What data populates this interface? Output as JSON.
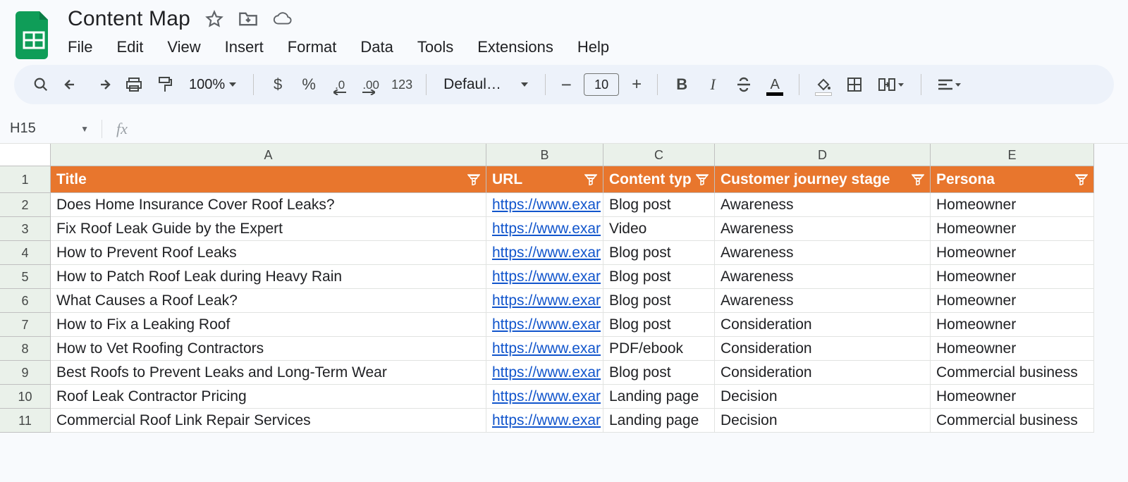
{
  "doc": {
    "title": "Content Map"
  },
  "menu": {
    "file": "File",
    "edit": "Edit",
    "view": "View",
    "insert": "Insert",
    "format": "Format",
    "data": "Data",
    "tools": "Tools",
    "extensions": "Extensions",
    "help": "Help"
  },
  "toolbar": {
    "zoom": "100%",
    "currency": "$",
    "percent": "%",
    "dec_dec": ".0",
    "inc_dec": ".00",
    "num123": "123",
    "font": "Defaul…",
    "font_size": "10",
    "bold": "B",
    "italic": "I",
    "text_color": "A"
  },
  "namebox": {
    "ref": "H15"
  },
  "formulabar": {
    "fx": "fx",
    "value": ""
  },
  "columns": [
    "A",
    "B",
    "C",
    "D",
    "E"
  ],
  "headers": {
    "title": "Title",
    "url": "URL",
    "content_type": "Content typ",
    "journey": "Customer journey stage",
    "persona": "Persona"
  },
  "rows": [
    {
      "n": "2",
      "title": "Does Home Insurance Cover Roof Leaks?",
      "url": "https://www.exar",
      "type": "Blog post",
      "stage": "Awareness",
      "persona": "Homeowner"
    },
    {
      "n": "3",
      "title": "Fix Roof Leak Guide by the Expert",
      "url": "https://www.exar",
      "type": "Video",
      "stage": "Awareness",
      "persona": "Homeowner"
    },
    {
      "n": "4",
      "title": "How to Prevent Roof Leaks",
      "url": "https://www.exar",
      "type": "Blog post",
      "stage": "Awareness",
      "persona": "Homeowner"
    },
    {
      "n": "5",
      "title": "How to Patch Roof Leak during Heavy Rain",
      "url": "https://www.exar",
      "type": "Blog post",
      "stage": "Awareness",
      "persona": "Homeowner"
    },
    {
      "n": "6",
      "title": "What Causes a Roof Leak?",
      "url": "https://www.exar",
      "type": "Blog post",
      "stage": "Awareness",
      "persona": "Homeowner"
    },
    {
      "n": "7",
      "title": "How to Fix a Leaking Roof",
      "url": "https://www.exar",
      "type": "Blog post",
      "stage": "Consideration",
      "persona": "Homeowner"
    },
    {
      "n": "8",
      "title": "How to Vet Roofing Contractors",
      "url": "https://www.exar",
      "type": "PDF/ebook",
      "stage": "Consideration",
      "persona": "Homeowner"
    },
    {
      "n": "9",
      "title": "Best Roofs to Prevent Leaks and Long-Term Wear",
      "url": "https://www.exar",
      "type": "Blog post",
      "stage": "Consideration",
      "persona": "Commercial business"
    },
    {
      "n": "10",
      "title": "Roof Leak Contractor Pricing",
      "url": "https://www.exar",
      "type": "Landing page",
      "stage": "Decision",
      "persona": "Homeowner"
    },
    {
      "n": "11",
      "title": "Commercial Roof Link Repair Services",
      "url": "https://www.exar",
      "type": "Landing page",
      "stage": "Decision",
      "persona": "Commercial business"
    }
  ]
}
